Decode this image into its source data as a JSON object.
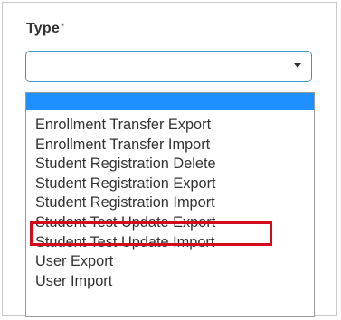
{
  "form": {
    "label": "Type",
    "required_marker": "*",
    "select_value": ""
  },
  "dropdown": {
    "options": [
      "",
      "Enrollment Transfer Export",
      "Enrollment Transfer Import",
      "Student Registration Delete",
      "Student Registration Export",
      "Student Registration Import",
      "Student Test Update Export",
      "Student Test Update Import",
      "User Export",
      "User Import"
    ],
    "highlighted_option": "Student Test Update Export"
  },
  "colors": {
    "selected_option_bg": "#1e90ff",
    "highlight_border": "#d20b1c",
    "select_border": "#3f97c8"
  }
}
